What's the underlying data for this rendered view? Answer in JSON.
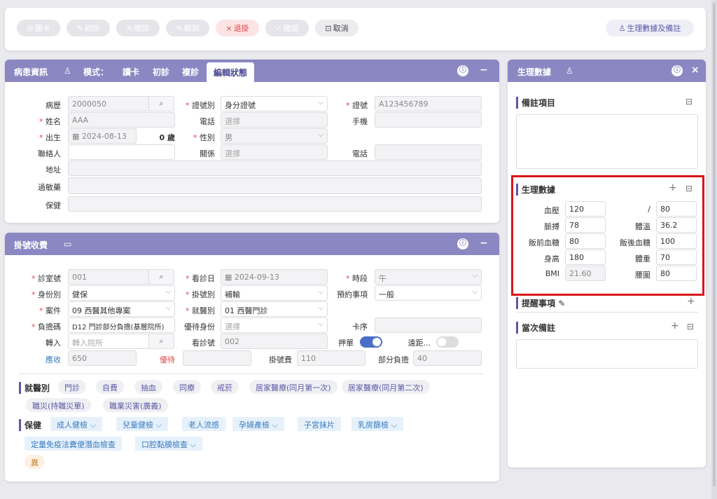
{
  "toolbar": {
    "read_card": "讀卡",
    "first_visit": "初診",
    "revisit": "複診",
    "register": "報到",
    "cancel_reg": "退掛",
    "confirm": "確認",
    "cancel": "取消",
    "vitals_notes": "生理數據及備註"
  },
  "patient": {
    "header": "病患資訊",
    "mode_label": "模式：",
    "tabs": [
      "讀卡",
      "初診",
      "複診",
      "編輯狀態"
    ],
    "fields": {
      "chart_label": "病歷",
      "chart_value": "2000050",
      "idtype_label": "證號別",
      "idtype_value": "身分證號",
      "idno_label": "證號",
      "idno_value": "A123456789",
      "name_label": "姓名",
      "name_value": "AAA",
      "phone_label": "電話",
      "phone_placeholder": "選擇",
      "mobile_label": "手機",
      "birth_label": "出生",
      "birth_value": "2024-08-13",
      "age_value": "0 歲",
      "sex_label": "性別",
      "sex_value": "男",
      "contact_label": "聯絡人",
      "relation_label": "關係",
      "relation_placeholder": "選擇",
      "phone2_label": "電話",
      "address_label": "地址",
      "allergy_label": "過敏藥",
      "insurance_label": "保健"
    }
  },
  "registration": {
    "header": "掛號收費",
    "fields": {
      "room_label": "診室號",
      "room_value": "001",
      "date_label": "看診日",
      "date_value": "2024-09-13",
      "period_label": "時段",
      "period_value": "午",
      "identity_label": "身份別",
      "identity_value": "健保",
      "regtype_label": "掛號別",
      "regtype_value": "補輸",
      "appt_label": "預約事項",
      "appt_value": "一般",
      "case_label": "案件",
      "case_value": "09 西醫其他專案",
      "dept_label": "就醫別",
      "dept_value": "01 西醫門診",
      "burden_label": "負擔碼",
      "burden_value": "D12 門診部分負擔(基層院所)",
      "priority_label": "優待身份",
      "priority_placeholder": "選擇",
      "cardseq_label": "卡序",
      "transfer_label": "轉入",
      "transfer_placeholder": "轉入院所",
      "visitno_label": "看診號",
      "visitno_value": "002",
      "deposit_label": "押單",
      "remote_label": "遠距...",
      "receivable_label": "應收",
      "receivable_value": "650",
      "discount_label": "優待",
      "regfee_label": "掛號費",
      "regfee_value": "110",
      "copay_label": "部分負擔",
      "copay_value": "40"
    },
    "visit_type_label": "就醫別",
    "visit_types": [
      "門診",
      "自費",
      "抽血",
      "同療",
      "戒菸",
      "居家醫療(同月第一次)",
      "居家醫療(同月第二次)",
      "職災(持職災單)",
      "職業災害(廣義)"
    ],
    "care_label": "保健",
    "care_items": [
      "成人健檢",
      "兒童健檢",
      "老人流感",
      "孕婦產檢",
      "子宮抹片",
      "乳房篩檢",
      "定量免疫法糞便潛血檢查",
      "口腔黏膜檢查"
    ],
    "abnormal": "異"
  },
  "vitals_panel": {
    "header": "生理數據",
    "notes_title": "備註項目",
    "vitals_title": "生理數據",
    "reminder_title": "提醒事項",
    "current_notes_title": "當次備註",
    "vitals": {
      "bp_label": "血壓",
      "bp_sys": "120",
      "bp_sep": "/",
      "bp_dia": "80",
      "pulse_label": "脈搏",
      "pulse": "78",
      "temp_label": "體溫",
      "temp": "36.2",
      "pre_glucose_label": "飯前血糖",
      "pre_glucose": "80",
      "post_glucose_label": "飯後血糖",
      "post_glucose": "100",
      "height_label": "身高",
      "height": "180",
      "weight_label": "體重",
      "weight": "70",
      "bmi_label": "BMI",
      "bmi": "21.60",
      "waist_label": "腰圍",
      "waist": "80"
    }
  }
}
